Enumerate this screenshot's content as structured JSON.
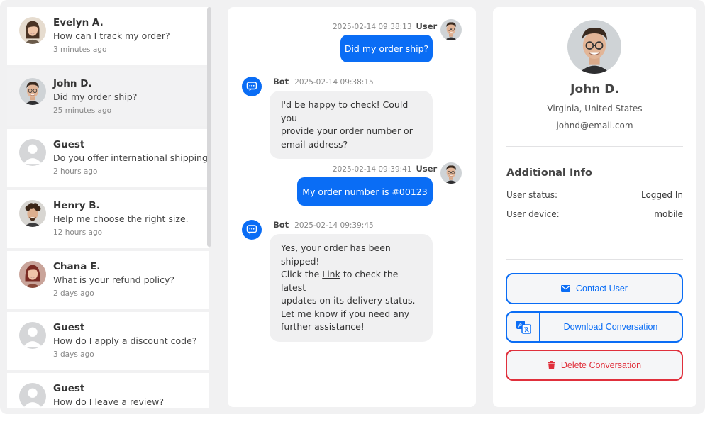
{
  "conversations": [
    {
      "name": "Evelyn A.",
      "message": "How can I track my order?",
      "time": "3 minutes ago",
      "avatar": "woman-photo"
    },
    {
      "name": "John D.",
      "message": "Did my order ship?",
      "time": "25 minutes ago",
      "avatar": "man-glasses-photo"
    },
    {
      "name": "Guest",
      "message": "Do you offer international shipping?",
      "time": "2 hours ago",
      "avatar": "default-user"
    },
    {
      "name": "Henry B.",
      "message": "Help me choose the right size.",
      "time": "12 hours ago",
      "avatar": "man-curly-photo"
    },
    {
      "name": "Chana E.",
      "message": "What is your refund policy?",
      "time": "2 days ago",
      "avatar": "woman-red-photo"
    },
    {
      "name": "Guest",
      "message": "How do I apply a discount code?",
      "time": "3 days ago",
      "avatar": "default-user"
    },
    {
      "name": "Guest",
      "message": "How do I leave a review?",
      "time": "",
      "avatar": "default-user"
    }
  ],
  "chat": {
    "messages": [
      {
        "sender": "User",
        "timestamp": "2025-02-14 09:38:13",
        "text": "Did my order ship?"
      },
      {
        "sender": "Bot",
        "timestamp": "2025-02-14 09:38:15",
        "lines": [
          "I'd be happy to check! Could you",
          "provide your order number or",
          "email address?"
        ]
      },
      {
        "sender": "User",
        "timestamp": "2025-02-14 09:39:41",
        "text": "My order number is #00123"
      },
      {
        "sender": "Bot",
        "timestamp": "2025-02-14 09:39:45",
        "line1": "Yes, your order has been shipped!",
        "line2_pre": "Click the ",
        "link": "Link",
        "line2_post": " to check the latest",
        "line3": "updates on its delivery status.",
        "line4": "Let me know if you need any",
        "line5": "further assistance!"
      }
    ]
  },
  "profile": {
    "name": "John D.",
    "location": "Virginia, United States",
    "email": "johnd@email.com",
    "additional_title": "Additional Info",
    "status_label": "User status:",
    "status_value": "Logged In",
    "device_label": "User device:",
    "device_value": "mobile",
    "contact_label": "Contact User",
    "download_label": "Download Conversation",
    "delete_label": "Delete Conversation"
  },
  "colors": {
    "accent": "#0a6df5",
    "danger": "#e0303c",
    "background": "#f1f1f2"
  }
}
